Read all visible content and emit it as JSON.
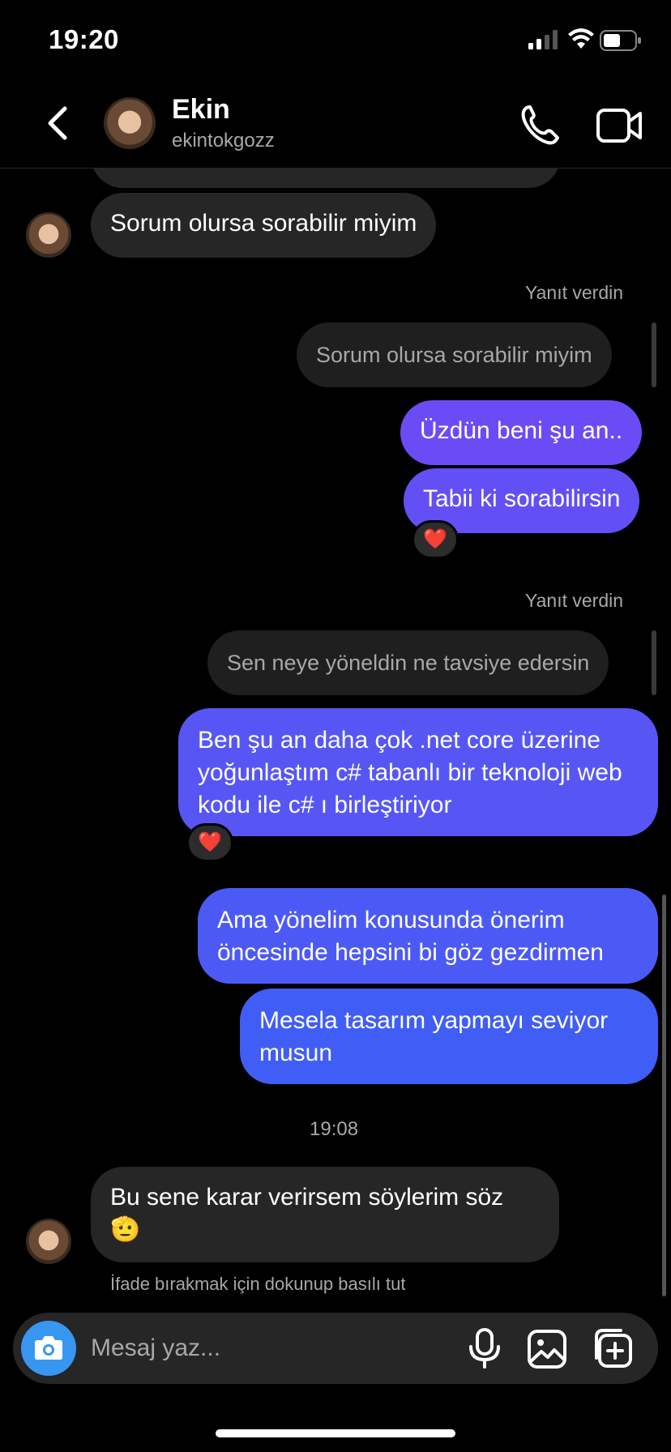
{
  "status_bar": {
    "time": "19:20"
  },
  "header": {
    "name": "Ekin",
    "username": "ekintokgozz"
  },
  "messages": {
    "m1": "Sorum olursa sorabilir miyim",
    "reply_label_1": "Yanıt verdin",
    "quote_1": "Sorum olursa sorabilir miyim",
    "m2": "Üzdün beni şu an..",
    "m3": "Tabii ki sorabilirsin",
    "reaction_1": "❤️",
    "reply_label_2": "Yanıt verdin",
    "quote_2": "Sen neye yöneldin ne tavsiye edersin",
    "m4": "Ben şu an daha çok .net core üzerine yoğunlaştım c# tabanlı bir teknoloji web kodu ile c# ı birleştiriyor",
    "reaction_2": "❤️",
    "m5": "Ama yönelim konusunda önerim öncesinde hepsini bi göz gezdirmen",
    "m6": "Mesela tasarım yapmayı seviyor musun",
    "timestamp": "19:08",
    "m7": "Bu sene karar verirsem söylerim söz 🫡",
    "hint": "İfade bırakmak için dokunup basılı tut"
  },
  "composer": {
    "placeholder": "Mesaj yaz..."
  },
  "colors": {
    "accent_blue": "#3797f0",
    "bubble_incoming": "#262626",
    "gradient_top": "#7a4cf6",
    "gradient_bottom": "#3e5ef5"
  },
  "icons": {
    "back": "chevron-left-icon",
    "call": "phone-icon",
    "video": "video-camera-icon",
    "camera": "camera-icon",
    "mic": "microphone-icon",
    "gallery": "image-icon",
    "sticker": "sticker-icon"
  }
}
